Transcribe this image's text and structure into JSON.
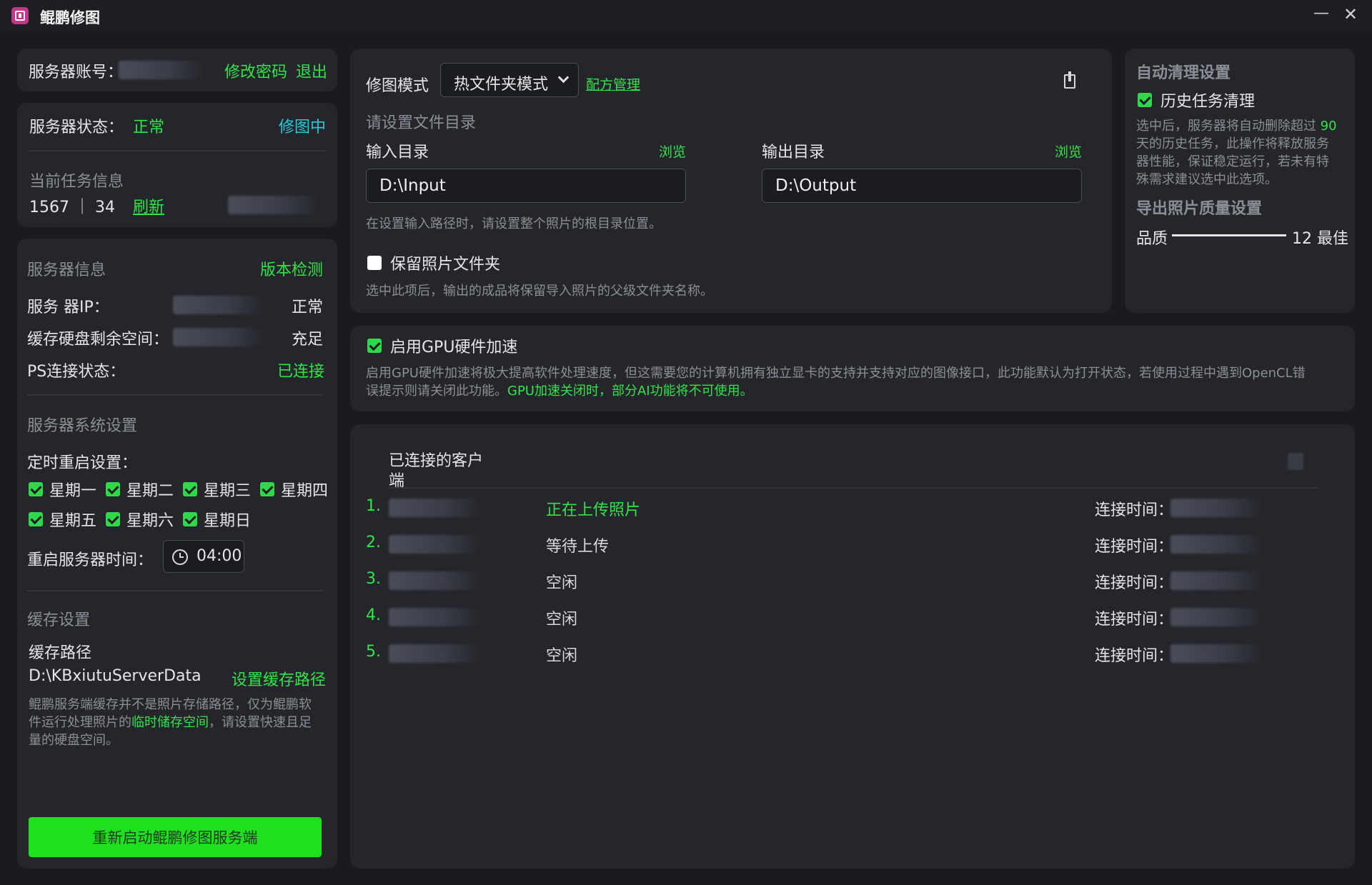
{
  "titlebar": {
    "app_name": "鲲鹏修图",
    "minimize": "—",
    "close": "✕"
  },
  "account": {
    "label": "服务器账号：",
    "change_password": "修改密码",
    "logout": "退出"
  },
  "status": {
    "label": "服务器状态：",
    "value": "正常",
    "mode": "修图中",
    "task_title": "当前任务信息",
    "task_counts": "1567 ｜ 34",
    "refresh": "刷新"
  },
  "server_info": {
    "title": "服务器信息",
    "version_check": "版本检测",
    "ip_label": "服务 器IP：",
    "ip_status": "正常",
    "disk_label": "缓存硬盘剩余空间：",
    "disk_status": "充足",
    "ps_label": "PS连接状态：",
    "ps_status": "已连接"
  },
  "system_settings": {
    "title": "服务器系统设置",
    "restart_label": "定时重启设置：",
    "days": [
      "星期一",
      "星期二",
      "星期三",
      "星期四",
      "星期五",
      "星期六",
      "星期日"
    ],
    "restart_time_label": "重启服务器时间：",
    "restart_time": "04:00"
  },
  "cache": {
    "title": "缓存设置",
    "path_label": "缓存路径",
    "path": "D:\\KBxiutuServerData",
    "set_path": "设置缓存路径",
    "note_1": "鲲鹏服务端缓存并不是照片存储路径，仅为鲲鹏软",
    "note_2a": "件运行处理照片的",
    "note_2b": "临时储存空间",
    "note_2c": "，请设置快速且足",
    "note_3": "量的硬盘空间。"
  },
  "restart_button": "重新启动鲲鹏修图服务端",
  "mode_panel": {
    "mode_label": "修图模式",
    "mode_value": "热文件夹模式",
    "recipe_link": "配方管理",
    "dir_title": "请设置文件目录",
    "input_label": "输入目录",
    "output_label": "输出目录",
    "browse": "浏览",
    "input_value": "D:\\Input",
    "output_value": "D:\\Output",
    "input_note": "在设置输入路径时，请设置整个照片的根目录位置。",
    "keep_folder_label": "保留照片文件夹",
    "keep_folder_note": "选中此项后，输出的成品将保留导入照片的父级文件夹名称。"
  },
  "auto_clean": {
    "title": "自动清理设置",
    "history_label": "历史任务清理",
    "note_1a": "选中后，服务器将自动删除超过 ",
    "note_1b": "90",
    "note_2": "天的历史任务，此操作将释放服务",
    "note_3": "器性能，保证稳定运行，若未有特",
    "note_4": "殊需求建议选中此选项。",
    "quality_title": "导出照片质量设置",
    "quality_label": "品质",
    "quality_value": "12 最佳"
  },
  "gpu": {
    "label": "启用GPU硬件加速",
    "note_1": "启用GPU硬件加速将极大提高软件处理速度，但这需要您的计算机拥有独立显卡的支持并支持对应的图像接口，此功能默认为打开状态，若使用过程中遇到OpenCL错",
    "note_2a": "误提示则请关闭此功能。",
    "note_2b": "GPU加速关闭时，部分AI功能将不可使用。"
  },
  "clients": {
    "title_1": "已连接的客户",
    "title_2": "端",
    "conn_label": "连接时间：",
    "rows": [
      {
        "index": "1.",
        "status": "正在上传照片",
        "active": true
      },
      {
        "index": "2.",
        "status": "等待上传",
        "active": false
      },
      {
        "index": "3.",
        "status": "空闲",
        "active": false
      },
      {
        "index": "4.",
        "status": "空闲",
        "active": false
      },
      {
        "index": "5.",
        "status": "空闲",
        "active": false
      }
    ]
  },
  "colors": {
    "accent": "#33e34a",
    "background": "#1a1b1f",
    "panel": "#25262b",
    "button": "#1fe01f",
    "logo": "#c4368a"
  }
}
